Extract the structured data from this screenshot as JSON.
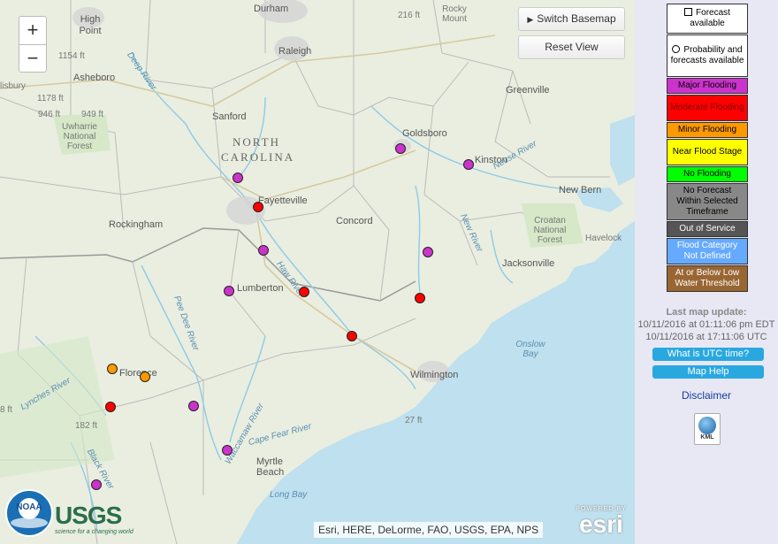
{
  "map": {
    "zoom_in": "+",
    "zoom_out": "−",
    "switch_basemap": "Switch Basemap",
    "reset_view": "Reset View",
    "attribution": "Esri, HERE, DeLorme, FAO, USGS, EPA, NPS",
    "esri_powered": "POWERED BY",
    "esri_logo": "esri",
    "noaa_logo": "NOAA",
    "usgs_logo": "USGS",
    "usgs_tagline": "science for a changing world"
  },
  "places": {
    "durham": "Durham",
    "raleigh": "Raleigh",
    "rocky_mount": "Rocky Mount",
    "high_point": "High Point",
    "asheboro": "Asheboro",
    "sanford": "Sanford",
    "goldsboro": "Goldsboro",
    "greenville": "Greenville",
    "kinston": "Kinston",
    "new_bern": "New Bern",
    "fayetteville": "Fayetteville",
    "concord": "Concord",
    "rockingham": "Rockingham",
    "lumberton": "Lumberton",
    "jacksonville": "Jacksonville",
    "havelock": "Havelock",
    "croatan": "Croatan National Forest",
    "uwharrie": "Uwharrie National Forest",
    "wilmington": "Wilmington",
    "florence": "Florence",
    "myrtle_beach": "Myrtle Beach",
    "long_bay": "Long Bay",
    "onslow_bay": "Onslow Bay",
    "north_carolina": "NORTH CAROLINA",
    "isbury": "lisbury",
    "elev_216": "216 ft",
    "elev_1154": "1154 ft",
    "elev_1178": "1178 ft",
    "elev_946": "946 ft",
    "elev_949": "949 ft",
    "elev_182": "182 ft",
    "elev_27": "27 ft",
    "elev_8": "8 ft",
    "haw_river": "Haw River",
    "neuse_river": "Neuse River",
    "deep_river": "Deep River",
    "pee_dee_river": "Pee Dee River",
    "lynches_river": "Lynches River",
    "black_river": "Black River",
    "waccamaw_river": "Waccamaw River",
    "new_river": "New River",
    "cape_fear_river": "Cape Fear River"
  },
  "gauges": [
    {
      "category": "major",
      "color": "#cc33cc"
    },
    {
      "category": "major",
      "color": "#cc33cc"
    },
    {
      "category": "major",
      "color": "#cc33cc"
    },
    {
      "category": "moderate",
      "color": "#ff0000"
    },
    {
      "category": "major",
      "color": "#cc33cc"
    },
    {
      "category": "major",
      "color": "#cc33cc"
    },
    {
      "category": "major",
      "color": "#cc33cc"
    },
    {
      "category": "moderate",
      "color": "#ff0000"
    },
    {
      "category": "moderate",
      "color": "#ff0000"
    },
    {
      "category": "moderate",
      "color": "#ff0000"
    },
    {
      "category": "minor",
      "color": "#ff9900"
    },
    {
      "category": "minor",
      "color": "#ff9900"
    },
    {
      "category": "moderate",
      "color": "#ff0000"
    },
    {
      "category": "major",
      "color": "#cc33cc"
    },
    {
      "category": "major",
      "color": "#cc33cc"
    },
    {
      "category": "major",
      "color": "#cc33cc"
    }
  ],
  "legend": [
    {
      "label": "Forecast available",
      "bg": "#ffffff",
      "color": "#000000",
      "symbol": "square"
    },
    {
      "label": "Probability and forecasts available",
      "bg": "#ffffff",
      "color": "#000000",
      "symbol": "circle"
    },
    {
      "label": "Major Flooding",
      "bg": "#cc33cc",
      "color": "#000000",
      "symbol": ""
    },
    {
      "label": "Moderate Flooding",
      "bg": "#ff0000",
      "color": "#7a0000",
      "symbol": ""
    },
    {
      "label": "Minor Flooding",
      "bg": "#ff9900",
      "color": "#000000",
      "symbol": ""
    },
    {
      "label": "Near Flood Stage",
      "bg": "#ffff00",
      "color": "#000000",
      "symbol": ""
    },
    {
      "label": "No Flooding",
      "bg": "#00ff00",
      "color": "#000000",
      "symbol": ""
    },
    {
      "label": "No Forecast Within Selected Timeframe",
      "bg": "#888888",
      "color": "#000000",
      "symbol": ""
    },
    {
      "label": "Out of Service",
      "bg": "#555555",
      "color": "#ffffff",
      "symbol": ""
    },
    {
      "label": "Flood Category Not Defined",
      "bg": "#66aaff",
      "color": "#ffffff",
      "symbol": ""
    },
    {
      "label": "At or Below Low Water Threshold",
      "bg": "#996633",
      "color": "#ffffff",
      "symbol": ""
    }
  ],
  "sidebar": {
    "last_update_label": "Last map update:",
    "update_edt": "10/11/2016 at 01:11:06 pm EDT",
    "update_utc": "10/11/2016 at 17:11:06 UTC",
    "utc_button": "What is UTC time?",
    "help_button": "Map Help",
    "disclaimer": "Disclaimer",
    "kml_label": "KML"
  }
}
